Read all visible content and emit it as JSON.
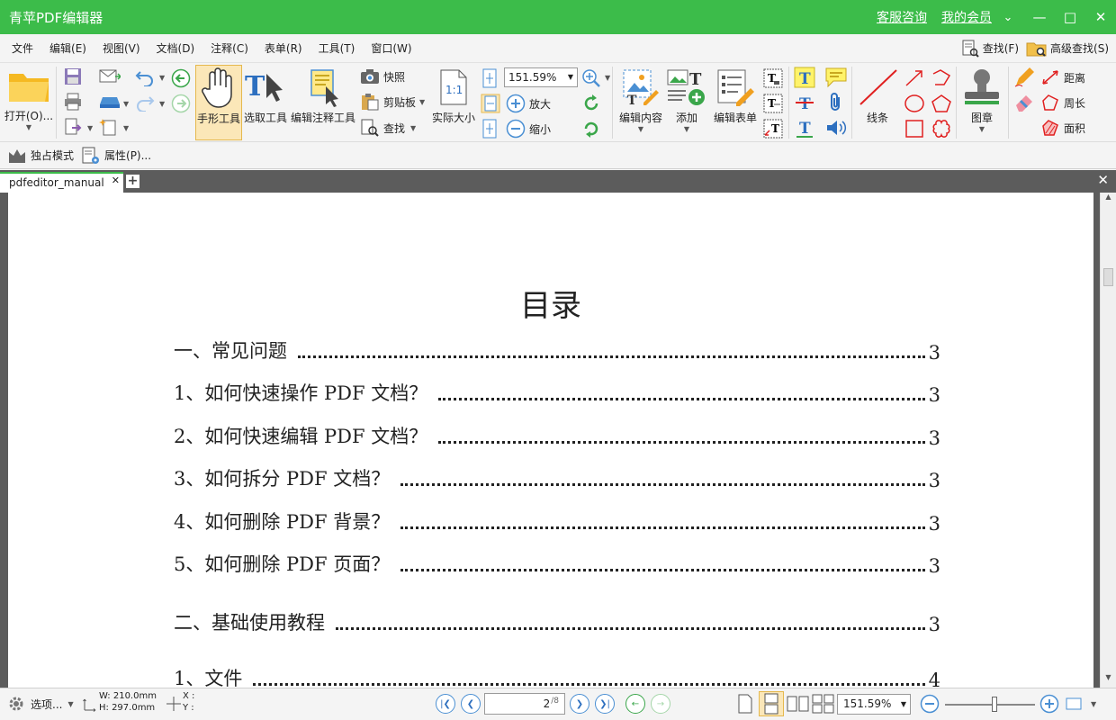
{
  "titlebar": {
    "title": "青苹PDF编辑器",
    "service_link": "客服咨询",
    "member_link": "我的会员"
  },
  "menu": {
    "items": [
      "文件",
      "编辑(E)",
      "视图(V)",
      "文档(D)",
      "注释(C)",
      "表单(R)",
      "工具(T)",
      "窗口(W)"
    ],
    "find": "查找(F)",
    "advanced_find": "高级查找(S)"
  },
  "ribbon": {
    "open": "打开(O)...",
    "hand_tool": "手形工具",
    "select_tool": "选取工具",
    "edit_annot_tool": "编辑注释工具",
    "snapshot": "快照",
    "clipboard": "剪贴板",
    "find": "查找",
    "actual_size": "实际大小",
    "zoom_value": "151.59%",
    "zoom_in": "放大",
    "zoom_out": "缩小",
    "edit_content": "编辑内容",
    "add": "添加",
    "edit_form": "编辑表单",
    "line": "线条",
    "stamp": "图章",
    "distance": "距离",
    "perimeter": "周长",
    "area": "面积"
  },
  "modebar": {
    "exclusive_mode": "独占模式",
    "properties": "属性(P)..."
  },
  "tabs": [
    {
      "label": "pdfeditor_manual"
    }
  ],
  "document": {
    "title": "目录",
    "toc": [
      {
        "text": "一、常见问题",
        "page": "3"
      },
      {
        "text": "1、如何快速操作 PDF 文档？",
        "page": "3"
      },
      {
        "text": "2、如何快速编辑 PDF 文档？",
        "page": "3"
      },
      {
        "text": "3、如何拆分 PDF 文档？",
        "page": "3"
      },
      {
        "text": "4、如何删除 PDF 背景？",
        "page": "3"
      },
      {
        "text": "5、如何删除 PDF 页面？",
        "page": "3"
      },
      {
        "text": "二、基础使用教程",
        "page": "3"
      },
      {
        "text": "1、文件",
        "page": "4"
      }
    ]
  },
  "statusbar": {
    "options": "选项...",
    "width": "W: 210.0mm",
    "height": "H: 297.0mm",
    "x": "X :",
    "y": "Y :",
    "current_page": "2",
    "total_pages": "/8",
    "zoom_value": "151.59%",
    "zoom_level": 0.55
  },
  "colors": {
    "titlebar": "#3cbc4a",
    "active_tool": "#fbe7b8",
    "doc_background": "#5c5c5c"
  }
}
